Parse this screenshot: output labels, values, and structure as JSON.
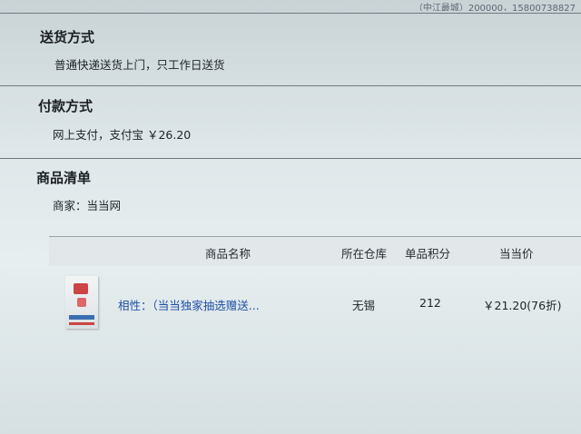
{
  "top_strip": "（中江最城）200000，15800738827",
  "delivery": {
    "title": "送货方式",
    "text": "普通快递送货上门，只工作日送货"
  },
  "payment": {
    "title": "付款方式",
    "text": "网上支付，支付宝 ￥26.20"
  },
  "products": {
    "title": "商品清单",
    "merchant": "商家：当当网",
    "columns": [
      "商品名称",
      "所在仓库",
      "单品积分",
      "当当价"
    ],
    "rows": [
      {
        "name": "相性：（当当独家抽选赠送...",
        "warehouse": "无锡",
        "points": "212",
        "price": "￥21.20(76折)"
      }
    ]
  }
}
